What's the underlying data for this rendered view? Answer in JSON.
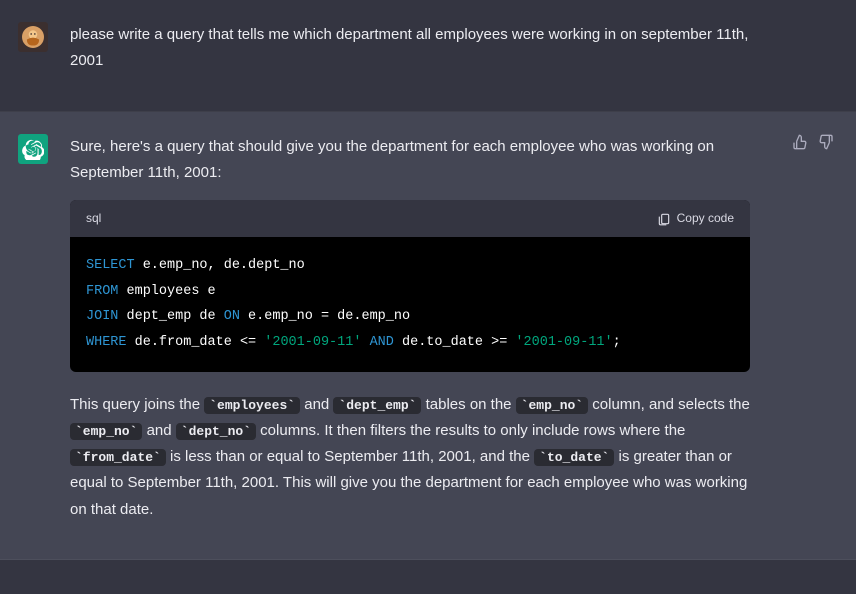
{
  "user_message": {
    "text": "please write a query that tells me which department all employees were working in on september 11th, 2001"
  },
  "assistant_message": {
    "intro": "Sure, here's a query that should give you the department for each employee who was working on September 11th, 2001:",
    "code": {
      "lang": "sql",
      "copy_label": "Copy code",
      "tokens": [
        [
          {
            "t": "SELECT",
            "c": "kw"
          },
          {
            "t": " e.emp_no, de.dept_no",
            "c": "id"
          }
        ],
        [
          {
            "t": "FROM",
            "c": "kw"
          },
          {
            "t": " employees e",
            "c": "id"
          }
        ],
        [
          {
            "t": "JOIN",
            "c": "kw"
          },
          {
            "t": " dept_emp de ",
            "c": "id"
          },
          {
            "t": "ON",
            "c": "kw"
          },
          {
            "t": " e.emp_no ",
            "c": "id"
          },
          {
            "t": "=",
            "c": "punc"
          },
          {
            "t": " de.emp_no",
            "c": "id"
          }
        ],
        [
          {
            "t": "WHERE",
            "c": "kw"
          },
          {
            "t": " de.from_date ",
            "c": "id"
          },
          {
            "t": "<=",
            "c": "punc"
          },
          {
            "t": " ",
            "c": "id"
          },
          {
            "t": "'2001-09-11'",
            "c": "str"
          },
          {
            "t": " ",
            "c": "id"
          },
          {
            "t": "AND",
            "c": "kw"
          },
          {
            "t": " de.to_date ",
            "c": "id"
          },
          {
            "t": ">=",
            "c": "punc"
          },
          {
            "t": " ",
            "c": "id"
          },
          {
            "t": "'2001-09-11'",
            "c": "str"
          },
          {
            "t": ";",
            "c": "punc"
          }
        ]
      ]
    },
    "explanation": {
      "parts": [
        {
          "text": "This query joins the "
        },
        {
          "code": "employees"
        },
        {
          "text": " and "
        },
        {
          "code": "dept_emp"
        },
        {
          "text": " tables on the "
        },
        {
          "code": "emp_no"
        },
        {
          "text": " column, and selects the "
        },
        {
          "code": "emp_no"
        },
        {
          "text": " and "
        },
        {
          "code": "dept_no"
        },
        {
          "text": " columns. It then filters the results to only include rows where the "
        },
        {
          "code": "from_date"
        },
        {
          "text": " is less than or equal to September 11th, 2001, and the "
        },
        {
          "code": "to_date"
        },
        {
          "text": " is greater than or equal to September 11th, 2001. This will give you the department for each employee who was working on that date."
        }
      ]
    }
  }
}
